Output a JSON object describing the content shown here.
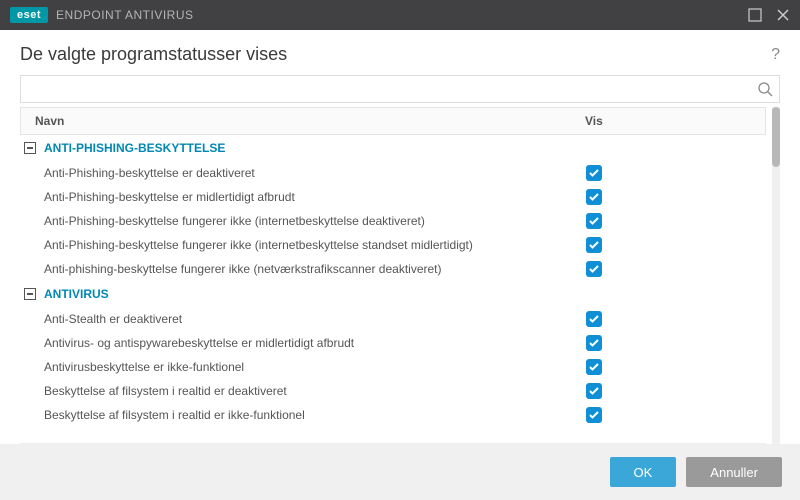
{
  "titlebar": {
    "brand": "eset",
    "app": "ENDPOINT ANTIVIRUS"
  },
  "page_title": "De valgte programstatusser vises",
  "search": {
    "placeholder": ""
  },
  "columns": {
    "name": "Navn",
    "vis": "Vis"
  },
  "groups": [
    {
      "title": "ANTI-PHISHING-BESKYTTELSE",
      "items": [
        {
          "label": "Anti-Phishing-beskyttelse er deaktiveret",
          "checked": true
        },
        {
          "label": "Anti-Phishing-beskyttelse er midlertidigt afbrudt",
          "checked": true
        },
        {
          "label": "Anti-Phishing-beskyttelse fungerer ikke (internetbeskyttelse deaktiveret)",
          "checked": true
        },
        {
          "label": "Anti-Phishing-beskyttelse fungerer ikke (internetbeskyttelse standset midlertidigt)",
          "checked": true
        },
        {
          "label": "Anti-phishing-beskyttelse fungerer ikke (netværkstrafikscanner deaktiveret)",
          "checked": true
        }
      ]
    },
    {
      "title": "ANTIVIRUS",
      "items": [
        {
          "label": "Anti-Stealth er deaktiveret",
          "checked": true
        },
        {
          "label": "Antivirus- og antispywarebeskyttelse er midlertidigt afbrudt",
          "checked": true
        },
        {
          "label": "Antivirusbeskyttelse er ikke-funktionel",
          "checked": true
        },
        {
          "label": "Beskyttelse af filsystem i realtid er deaktiveret",
          "checked": true
        },
        {
          "label": "Beskyttelse af filsystem i realtid er ikke-funktionel",
          "checked": true
        }
      ]
    }
  ],
  "buttons": {
    "ok": "OK",
    "cancel": "Annuller"
  }
}
